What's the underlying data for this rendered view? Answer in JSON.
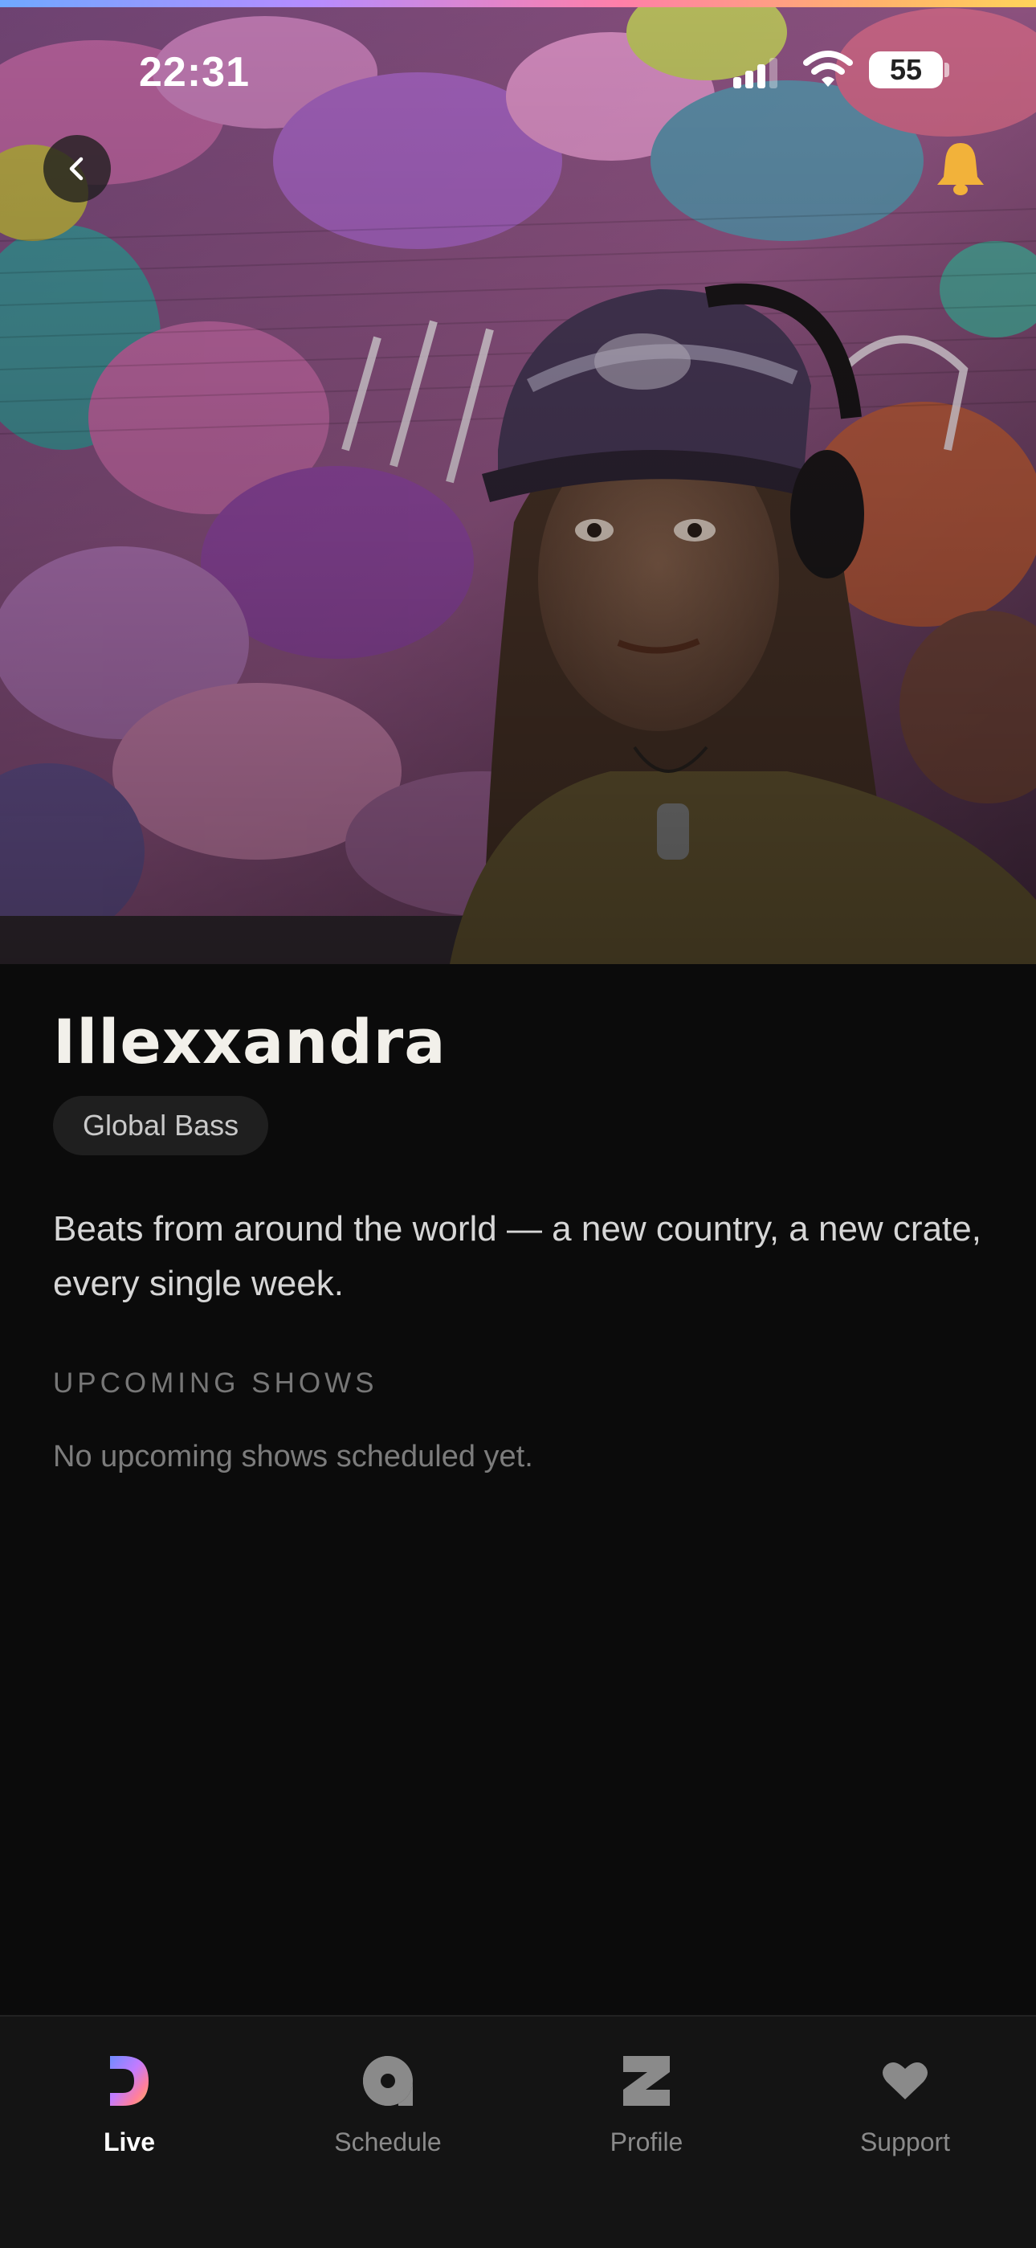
{
  "status_bar": {
    "time": "22:31",
    "battery": "55"
  },
  "hero": {
    "image_alt": "Artist photo"
  },
  "header": {
    "back_icon": "chevron-left-icon",
    "notify_icon": "bell-icon"
  },
  "artist": {
    "name": "Illexxandra",
    "genre": "Global Bass",
    "description": "Beats from around the world — a new country, a new crate, every single week."
  },
  "upcoming": {
    "heading": "UPCOMING SHOWS",
    "empty_message": "No upcoming shows scheduled yet."
  },
  "tabs": [
    {
      "label": "Live",
      "icon": "live-logo-icon",
      "active": true
    },
    {
      "label": "Schedule",
      "icon": "schedule-icon",
      "active": false
    },
    {
      "label": "Profile",
      "icon": "profile-icon",
      "active": false
    },
    {
      "label": "Support",
      "icon": "heart-icon",
      "active": false
    }
  ],
  "colors": {
    "background": "#0b0b0b",
    "tab_bar": "#141414",
    "bell": "#f2b23a",
    "accent_gradient": [
      "#6fa8ff",
      "#b58cff",
      "#ff7fa8",
      "#ffb36b",
      "#ffd45a"
    ]
  }
}
